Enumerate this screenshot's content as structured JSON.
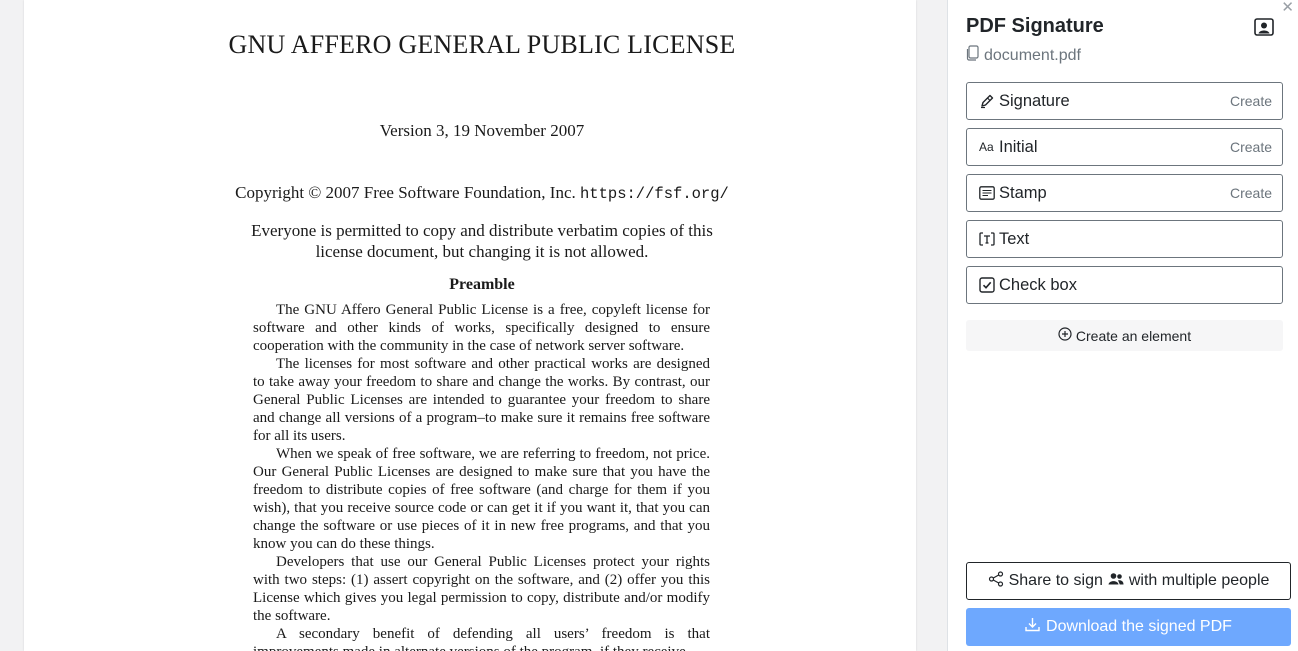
{
  "document": {
    "title": "GNU AFFERO GENERAL PUBLIC LICENSE",
    "version": "Version 3, 19 November 2007",
    "copyright_prefix": "Copyright © 2007 Free Software Foundation, Inc.",
    "copyright_url": "https://fsf.org/",
    "permission": "Everyone is permitted to copy and distribute verbatim copies of this license document, but changing it is not allowed.",
    "heading": "Preamble",
    "paragraphs": [
      "The GNU Affero General Public License is a free, copyleft license for software and other kinds of works, specifically designed to ensure cooperation with the community in the case of network server software.",
      "The licenses for most software and other practical works are designed to take away your freedom to share and change the works. By contrast, our General Public Licenses are intended to guarantee your freedom to share and change all versions of a program–to make sure it remains free software for all its users.",
      "When we speak of free software, we are referring to freedom, not price. Our General Public Licenses are designed to make sure that you have the freedom to distribute copies of free software (and charge for them if you wish), that you receive source code or can get it if you want it, that you can change the software or use pieces of it in new free programs, and that you know you can do these things.",
      "Developers that use our General Public Licenses protect your rights with two steps: (1) assert copyright on the software, and (2) offer you this License which gives you legal permission to copy, distribute and/or modify the software.",
      "A secondary benefit of defending all users’ freedom is that improvements made in alternate versions of the program, if they receive"
    ]
  },
  "sidebar": {
    "close_icon": "close-icon",
    "title": "PDF Signature",
    "profile_icon": "person-badge-icon",
    "filename_icon": "files-icon",
    "filename": "document.pdf",
    "tools": [
      {
        "icon": "pen-icon",
        "label": "Signature",
        "action": "Create"
      },
      {
        "icon": "initials-icon",
        "label": "Initial",
        "action": "Create"
      },
      {
        "icon": "stamp-icon",
        "label": "Stamp",
        "action": "Create"
      },
      {
        "icon": "text-field-icon",
        "label": "Text",
        "action": ""
      },
      {
        "icon": "checkbox-icon",
        "label": "Check box",
        "action": ""
      }
    ],
    "initials_glyph": "Aa",
    "create_element": "Create an element",
    "share_label_1": "Share to sign",
    "share_label_2": "with multiple people",
    "download_label": "Download the signed PDF",
    "accent_color": "#6ea8fe"
  }
}
